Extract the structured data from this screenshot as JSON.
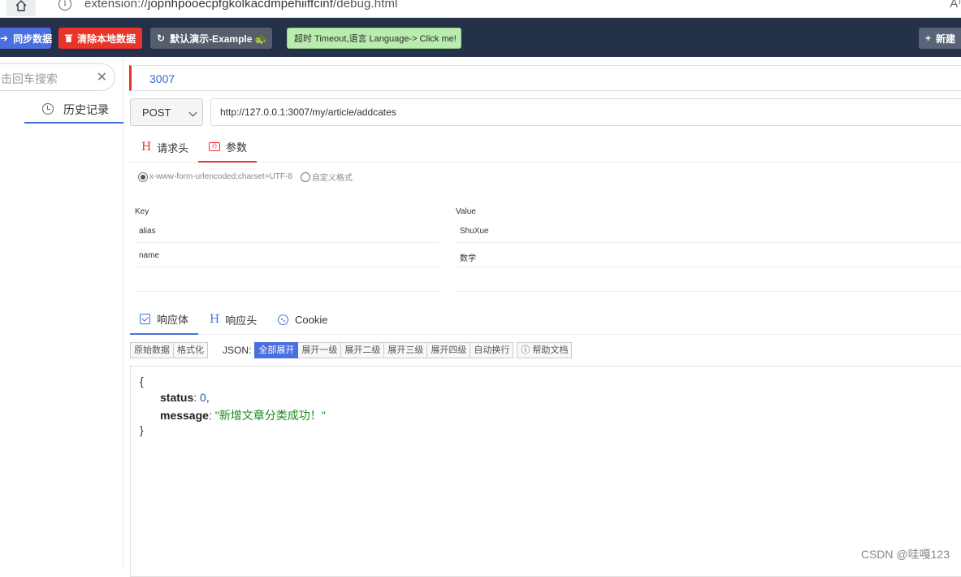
{
  "browser": {
    "url_prefix": "extension://",
    "url_host": "jopnhpooecpfgkolkacdmpehiiffcinf",
    "url_path": "/debug.html",
    "reader_icon": "A⁾"
  },
  "toolbar": {
    "sync_label": "同步数据",
    "clear_label": "清除本地数据",
    "demo_label": "默认演示-Example 🐢",
    "timeout_label": "超时 Timeout,语言 Language-> Click me!",
    "new_label": "新建"
  },
  "sidebar": {
    "search_placeholder": "击回车搜索",
    "history_label": "历史记录"
  },
  "request": {
    "name": "3007",
    "method": "POST",
    "url": "http://127.0.0.1:3007/my/article/addcates",
    "tabs": [
      "请求头",
      "参数"
    ],
    "encoding_options": [
      "x-www-form-urlencoded;charset=UTF-8",
      "自定义格式"
    ],
    "params_header": {
      "key": "Key",
      "value": "Value"
    },
    "params": [
      {
        "key": "alias",
        "value": "ShuXue"
      },
      {
        "key": "name",
        "value": "数学"
      }
    ]
  },
  "response": {
    "tabs": [
      "响应体",
      "响应头",
      "Cookie"
    ],
    "view_buttons": [
      "原始数据",
      "格式化"
    ],
    "json_label": "JSON:",
    "expand_buttons": [
      "全部展开",
      "展开一级",
      "展开二级",
      "展开三级",
      "展开四级",
      "自动换行"
    ],
    "help_label": "帮助文档",
    "body": {
      "open": "{",
      "status_key": "status",
      "status_value": "0",
      "message_key": "message",
      "message_value": "\"新增文章分类成功！\"",
      "close": "}"
    }
  },
  "watermark": "CSDN @哇嘎123",
  "colors": {
    "toolbar_bg": "#243149",
    "accent_blue": "#4a6fe0",
    "accent_red": "#e8352a"
  }
}
